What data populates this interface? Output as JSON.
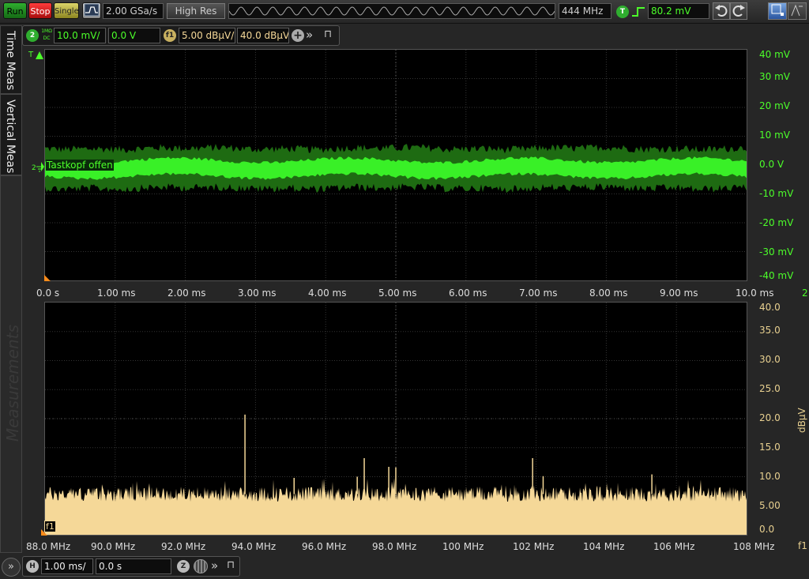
{
  "toolbar": {
    "run_label": "Run",
    "stop_label": "Stop",
    "single_label": "Single",
    "sample_rate": "2.00 GSa/s",
    "acq_mode": "High Res",
    "bandwidth": "444 MHz",
    "trigger_badge": "T",
    "trigger_level": "80.2 mV"
  },
  "channel": {
    "number": "2",
    "coupling_top": "1MΩ",
    "coupling_bottom": "DC",
    "scale": "10.0 mV/",
    "offset": "0.0 V",
    "fft_badge": "f1",
    "fft_scale": "5.00 dBµV/",
    "fft_ref": "40.0 dBµV"
  },
  "sidetabs": {
    "time_meas": "Time Meas",
    "vertical_meas": "Vertical Meas",
    "measurements": "Measurements"
  },
  "waveform": {
    "trigger_marker": "T",
    "channel_marker": "2",
    "label": "Tastkopf offen",
    "y_labels": [
      "40 mV",
      "30 mV",
      "20 mV",
      "10 mV",
      "0.0 V",
      "-10 mV",
      "-20 mV",
      "-30 mV",
      "-40 mV"
    ],
    "x_labels": [
      "0.0 s",
      "1.00 ms",
      "2.00 ms",
      "3.00 ms",
      "4.00 ms",
      "5.00 ms",
      "6.00 ms",
      "7.00 ms",
      "8.00 ms",
      "9.00 ms",
      "10.0 ms"
    ],
    "right_marker": "2"
  },
  "fft": {
    "marker": "f1",
    "y_labels": [
      "40.0",
      "35.0",
      "30.0",
      "25.0",
      "20.0",
      "15.0",
      "10.0",
      "5.00",
      "0.0"
    ],
    "unit": "dBµV",
    "x_labels": [
      "88.0 MHz",
      "90.0 MHz",
      "92.0 MHz",
      "94.0 MHz",
      "96.0 MHz",
      "98.0 MHz",
      "100 MHz",
      "102 MHz",
      "104 MHz",
      "106 MHz",
      "108 MHz"
    ],
    "right_marker": "f1"
  },
  "timebase": {
    "badge": "H",
    "scale": "1.00 ms/",
    "delay": "0.0 s",
    "zoom_badge": "Z"
  },
  "colors": {
    "trace": "#3cff2a",
    "fft": "#f5d898",
    "run": "#1e8c1e",
    "stop": "#d01818",
    "single": "#c8c040"
  },
  "chart_data": {
    "type": "area",
    "x_start_mhz": 88.0,
    "x_end_mhz": 108.0,
    "ylim": [
      0,
      40
    ],
    "noise_floor_dbuv": 7,
    "peaks": [
      {
        "x": 93.7,
        "y": 20.7
      },
      {
        "x": 95.1,
        "y": 9.8
      },
      {
        "x": 96.9,
        "y": 10.0
      },
      {
        "x": 97.1,
        "y": 13.2
      },
      {
        "x": 97.8,
        "y": 11.7
      },
      {
        "x": 98.0,
        "y": 11.6
      },
      {
        "x": 101.9,
        "y": 13.2
      },
      {
        "x": 102.2,
        "y": 10.1
      },
      {
        "x": 105.3,
        "y": 10.4
      }
    ]
  }
}
